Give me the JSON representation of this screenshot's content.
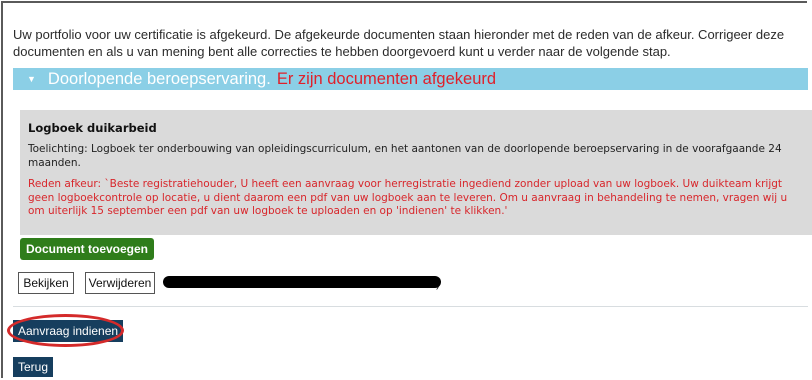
{
  "intro_text": "Uw portfolio voor uw certificatie is afgekeurd. De afgekeurde documenten staan hieronder met de reden van de afkeur. Corrigeer deze documenten en als u van mening bent alle correcties te hebben doorgevoerd kunt u verder naar de volgende stap.",
  "section": {
    "title": "Doorlopende beroepservaring.",
    "error": "Er zijn documenten afgekeurd"
  },
  "document": {
    "title": "Logboek duikarbeid",
    "description": "Toelichting: Logboek ter onderbouwing van opleidingscurriculum, en het aantonen van de doorlopende beroepservaring in de voorafgaande 24 maanden.",
    "reason": "Reden afkeur: `Beste registratiehouder, U heeft een aanvraag voor herregistratie ingediend zonder upload van uw logboek. Uw duikteam krijgt geen logboekcontrole op locatie, u dient daarom een pdf van uw logboek aan te leveren. Om u aanvraag in behandeling te nemen, vragen wij u om uiterlijk 15 september een pdf van uw logboek te uploaden en op 'indienen' te klikken.'"
  },
  "buttons": {
    "add_document": "Document toevoegen",
    "view": "Bekijken",
    "delete": "Verwijderen",
    "submit": "Aanvraag indienen",
    "back": "Terug"
  },
  "file": {
    "name_visible_fragment": ")"
  },
  "colors": {
    "section_bar": "#8bcfe6",
    "error_red": "#e0202a",
    "add_button": "#2f7d1b",
    "navy_button": "#163e5e",
    "annotation_circle": "#d42a2a"
  }
}
